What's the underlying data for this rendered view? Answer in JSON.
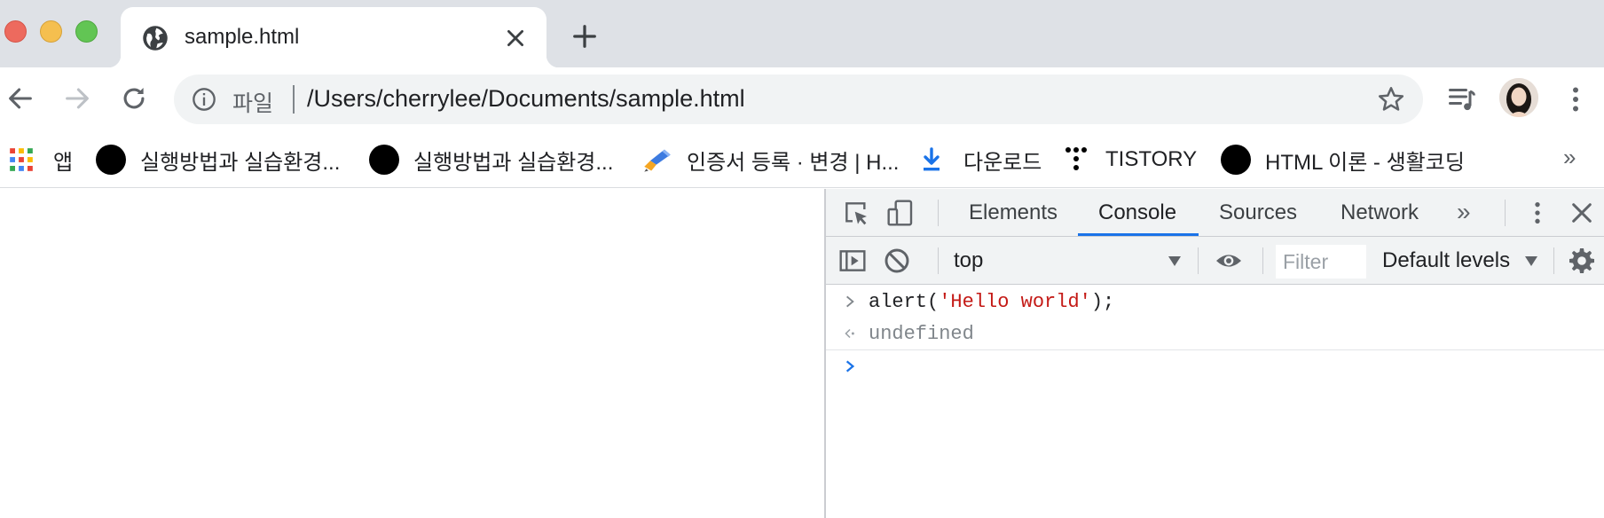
{
  "window": {
    "traffic_lights": {
      "close": "#ed6a5e",
      "minimize": "#f5bf4f",
      "maximize": "#62c554"
    }
  },
  "tab": {
    "title": "sample.html",
    "favicon": "globe-icon"
  },
  "toolbar": {
    "back_icon": "arrow-left-icon",
    "forward_icon": "arrow-right-icon",
    "reload_icon": "reload-icon",
    "omnibox": {
      "scheme_label": "파일",
      "url": "/Users/cherrylee/Documents/sample.html",
      "info_icon": "info-icon",
      "bookmark_icon": "star-icon"
    },
    "media_icon": "media-queue-icon",
    "menu_icon": "kebab-menu-icon"
  },
  "bookmarks": {
    "items": [
      {
        "label": "앱",
        "icon": "apps-grid-icon"
      },
      {
        "label": "실행방법과 실습환경...",
        "icon": "black-circle-icon"
      },
      {
        "label": "실행방법과 실습환경...",
        "icon": "black-circle-icon"
      },
      {
        "label": "인증서 등록 · 변경 | H...",
        "icon": "cert-pen-icon"
      },
      {
        "label": "다운로드",
        "icon": "download-icon"
      },
      {
        "label": "TISTORY",
        "icon": "tistory-icon"
      },
      {
        "label": "HTML 이론 - 생활코딩",
        "icon": "black-circle-icon"
      }
    ],
    "overflow": "»"
  },
  "devtools": {
    "tabs": [
      {
        "label": "Elements",
        "active": false
      },
      {
        "label": "Console",
        "active": true
      },
      {
        "label": "Sources",
        "active": false
      },
      {
        "label": "Network",
        "active": false
      }
    ],
    "more_tabs": "»",
    "console_toolbar": {
      "context": "top",
      "filter_placeholder": "Filter",
      "levels": "Default levels"
    },
    "console": {
      "input_fn": "alert(",
      "input_str": "'Hello world'",
      "input_end": ");",
      "result": "undefined"
    },
    "accent": "#1a73e8"
  }
}
